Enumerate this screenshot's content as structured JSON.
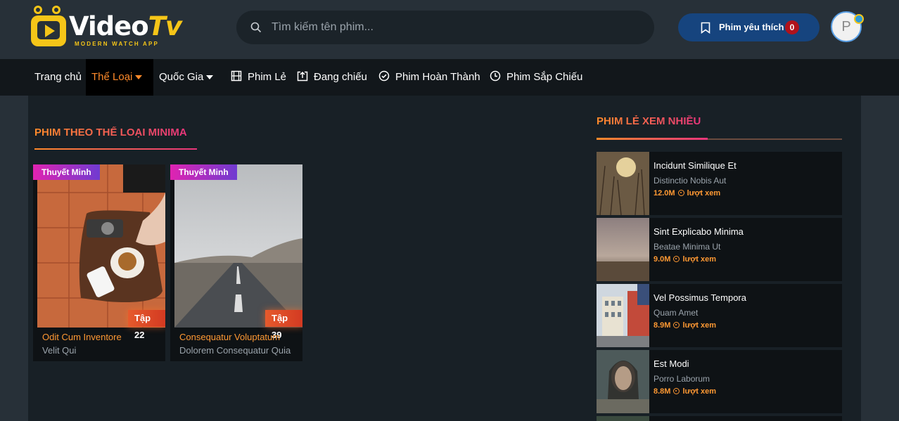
{
  "brand": {
    "name_part1": "Video",
    "name_part2": "Tv",
    "tagline": "MODERN WATCH APP"
  },
  "search": {
    "placeholder": "Tìm kiếm tên phim..."
  },
  "favorites": {
    "label": "Phim yêu thích",
    "count": "0"
  },
  "user": {
    "avatar_initial": "P"
  },
  "nav": {
    "home": "Trang chủ",
    "genre": "Thể Loại",
    "country": "Quốc Gia",
    "single": "Phim Lẻ",
    "showing": "Đang chiếu",
    "completed": "Phim Hoàn Thành",
    "upcoming": "Phim Sắp Chiếu"
  },
  "section": {
    "title": "PHIM THEO THỂ LOẠI MINIMA"
  },
  "movies": [
    {
      "badge": "Thuyết Minh",
      "episode": "Tập 22",
      "title": "Odit Cum Inventore",
      "subtitle": "Velit Qui"
    },
    {
      "badge": "Thuyết Minh",
      "episode": "Tập 39",
      "title": "Consequatur Voluptatum",
      "subtitle": "Dolorem Consequatur Quia"
    }
  ],
  "sidebar": {
    "title": "PHIM LẺ XEM NHIỀU",
    "views_suffix": "lượt xem",
    "items": [
      {
        "title": "Incidunt Similique Et",
        "subtitle": "Distinctio Nobis Aut",
        "views": "12.0M"
      },
      {
        "title": "Sint Explicabo Minima",
        "subtitle": "Beatae Minima Ut",
        "views": "9.0M"
      },
      {
        "title": "Vel Possimus Tempora",
        "subtitle": "Quam Amet",
        "views": "8.9M"
      },
      {
        "title": "Est Modi",
        "subtitle": "Porro Laborum",
        "views": "8.8M"
      }
    ]
  },
  "colors": {
    "accent_orange": "#ff8a2a",
    "accent_pink": "#e9357c",
    "brand_yellow": "#f5c518",
    "fav_blue": "#16447e"
  }
}
